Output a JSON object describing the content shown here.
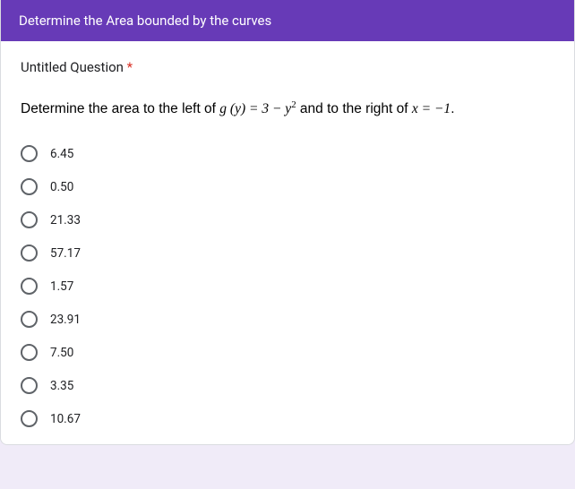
{
  "header": {
    "title": "Determine the Area bounded by the curves"
  },
  "question": {
    "title": "Untitled Question",
    "required_mark": "*",
    "prompt_prefix": "Determine the area to the left of ",
    "prompt_func": "g (y) = 3 − y",
    "prompt_exp": "2",
    "prompt_mid": " and to the right of ",
    "prompt_var": "x = −1",
    "prompt_suffix": "."
  },
  "options": [
    {
      "label": "6.45"
    },
    {
      "label": "0.50"
    },
    {
      "label": "21.33"
    },
    {
      "label": "57.17"
    },
    {
      "label": "1.57"
    },
    {
      "label": "23.91"
    },
    {
      "label": "7.50"
    },
    {
      "label": "3.35"
    },
    {
      "label": "10.67"
    }
  ]
}
